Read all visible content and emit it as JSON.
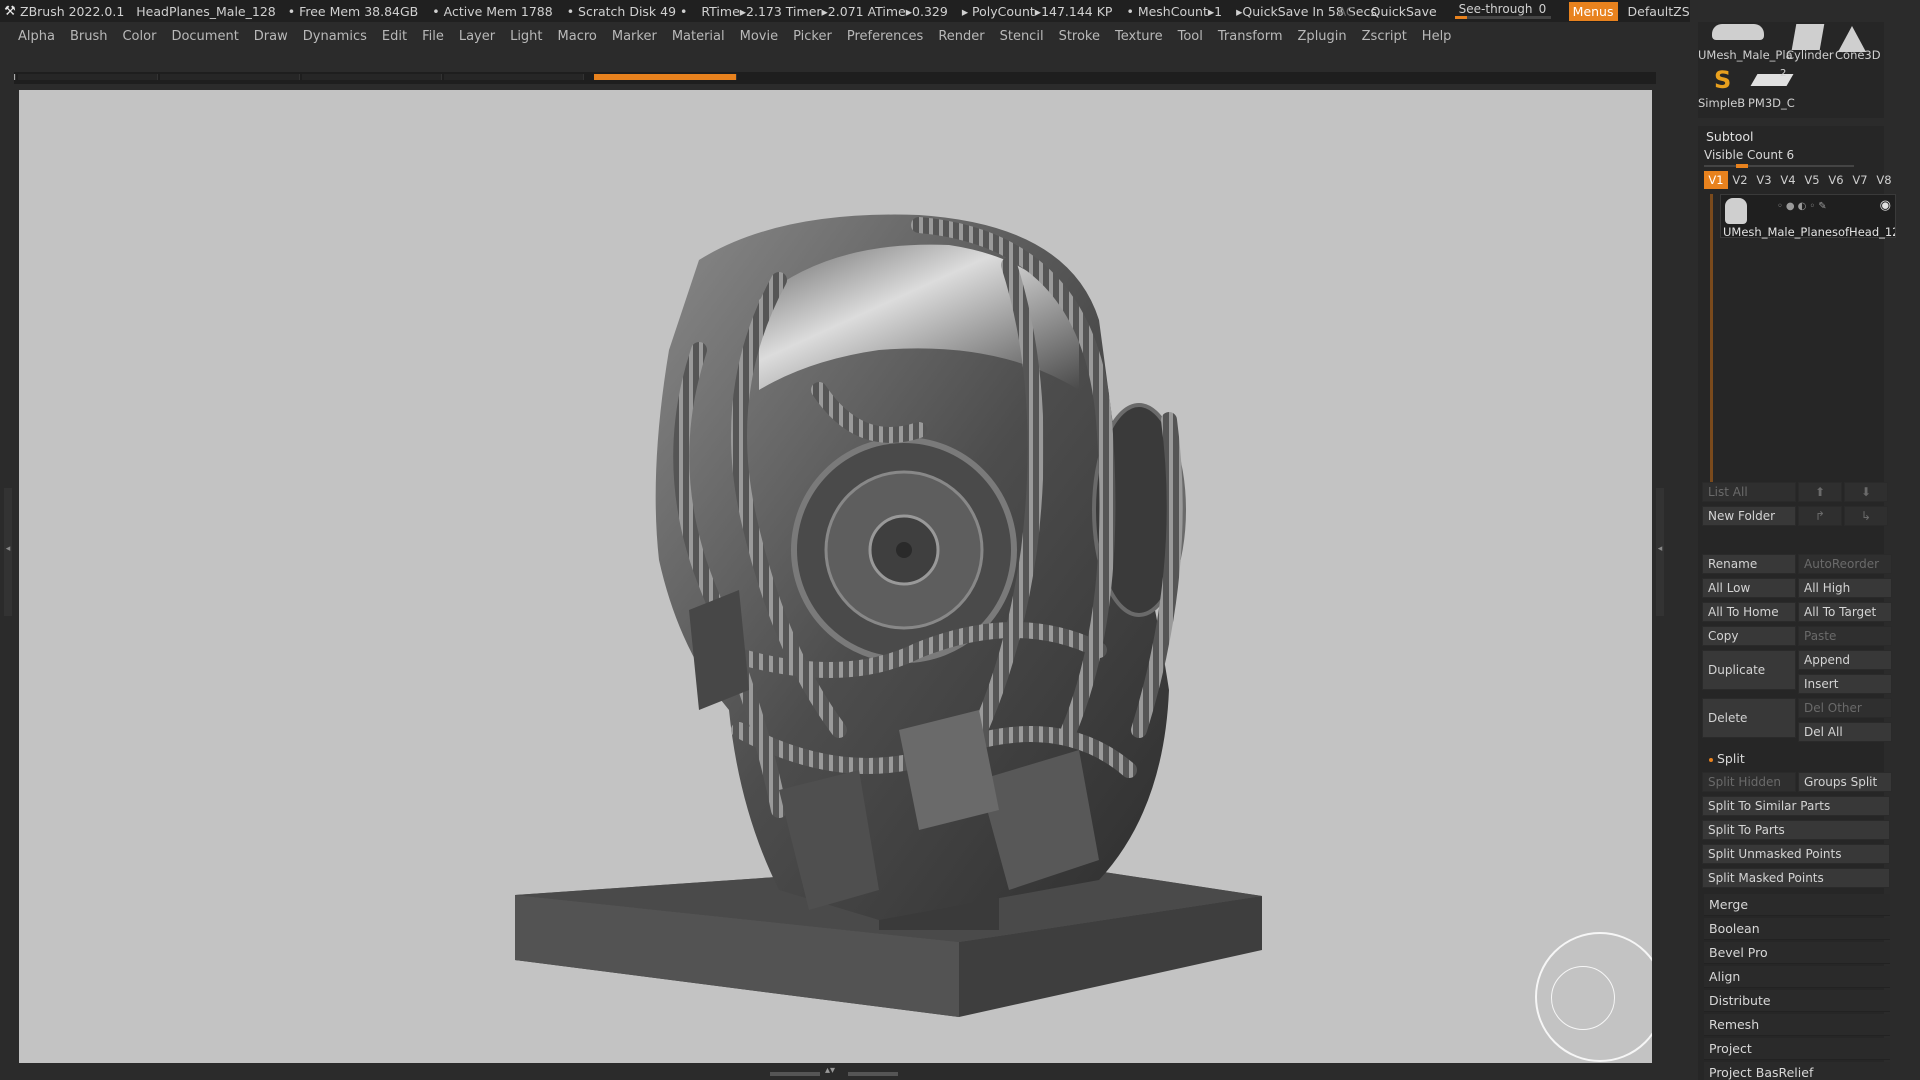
{
  "titlebar": {
    "app": "ZBrush 2022.0.1",
    "document": "HeadPlanes_Male_128",
    "free_mem": "• Free Mem 38.84GB",
    "active_mem": "• Active Mem 1788",
    "scratch": "• Scratch Disk 49 •",
    "rtime": "RTime▸2.173 Timer▸2.071 ATime▸0.329",
    "polycount": "▸ PolyCount▸147.144 KP",
    "meshcount": "• MeshCount▸1",
    "quicksave_timer": "▸QuickSave In 58 Secs",
    "ac": "AC",
    "quicksave": "QuickSave",
    "see_through_label": "See-through",
    "see_through_value": "0",
    "menus": "Menus",
    "default_script": "DefaultZScript"
  },
  "menubar": [
    "Alpha",
    "Brush",
    "Color",
    "Document",
    "Draw",
    "Dynamics",
    "Edit",
    "File",
    "Layer",
    "Light",
    "Macro",
    "Marker",
    "Material",
    "Movie",
    "Picker",
    "Preferences",
    "Render",
    "Stencil",
    "Stroke",
    "Texture",
    "Tool",
    "Transform",
    "Zplugin",
    "Zscript",
    "Help"
  ],
  "tools": {
    "row1": [
      "UMesh_Male_Pla",
      "Cylinder",
      "Cone3D"
    ],
    "row2": [
      "SimpleB",
      "PM3D_C"
    ],
    "badge": "2"
  },
  "subtool": {
    "title": "Subtool",
    "visible_count": "Visible Count 6",
    "version_tabs": [
      "V1",
      "V2",
      "V3",
      "V4",
      "V5",
      "V6",
      "V7",
      "V8"
    ],
    "active_tab": "V1",
    "item_name": "UMesh_Male_PlanesofHead_12",
    "buttons": {
      "list_all": "List All",
      "new_folder": "New Folder",
      "rename": "Rename",
      "autoreorder": "AutoReorder",
      "all_low": "All Low",
      "all_high": "All High",
      "all_to_home": "All To Home",
      "all_to_target": "All To Target",
      "copy": "Copy",
      "paste": "Paste",
      "duplicate": "Duplicate",
      "append": "Append",
      "insert": "Insert",
      "delete": "Delete",
      "del_other": "Del Other",
      "del_all": "Del All"
    },
    "split": {
      "title": "Split",
      "split_hidden": "Split Hidden",
      "groups_split": "Groups Split",
      "similar": "Split To Similar Parts",
      "parts": "Split To Parts",
      "unmasked": "Split Unmasked Points",
      "masked": "Split Masked Points"
    },
    "sections": [
      "Merge",
      "Boolean",
      "Bevel Pro",
      "Align",
      "Distribute",
      "Remesh",
      "Project",
      "Project BasRelief"
    ]
  },
  "colors": {
    "accent": "#e8821e",
    "viewport": "#c3c3c3",
    "panel": "#262626"
  }
}
